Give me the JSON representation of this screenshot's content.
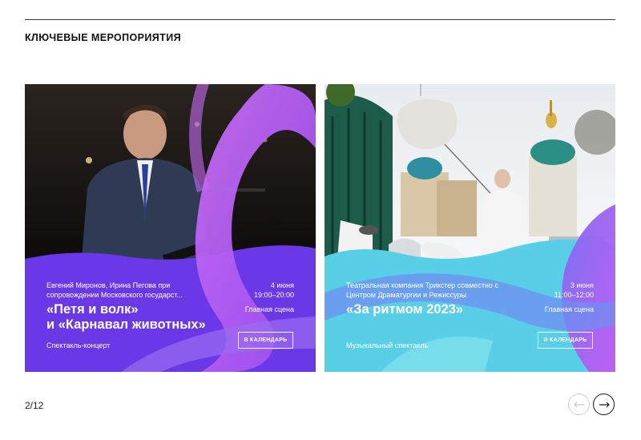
{
  "section": {
    "title": "КЛЮЧЕВЫЕ МЕРОПОРИЯТИЯ"
  },
  "cards": [
    {
      "description": "Евгений Миронов, Ирина Пегова при сопровождении Московского государст...",
      "date": "4 июня",
      "time": "19:00–20:00",
      "venue": "Главная сцена",
      "title_line1": "«Петя и волк»",
      "title_line2": "и «Карнавал животных»",
      "type": "Спектакль-концерт",
      "button_label": "В КАЛЕНДАРЬ",
      "accent_color": "#6a38e6"
    },
    {
      "description": "Театральная компания Трикстер совместно с Центром Драматургии и Режиссуры",
      "date": "3 июня",
      "time": "11:00–12:00",
      "venue": "Главная сцена",
      "title_line1": "«За ритмом 2023»",
      "title_line2": "",
      "type": "Музыкальный спектакль",
      "button_label": "В КАЛЕНДАРЬ",
      "accent_color": "#58cfe6"
    }
  ],
  "pagination": {
    "label": "2/12"
  },
  "icons": {
    "prev": "arrow-left-icon",
    "next": "arrow-right-icon"
  }
}
